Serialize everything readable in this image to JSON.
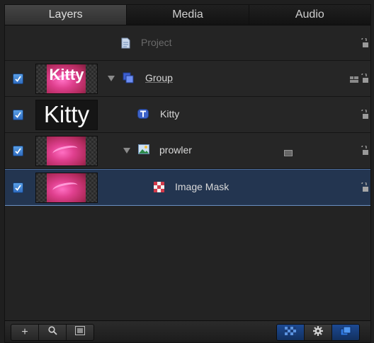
{
  "tabs": [
    {
      "label": "Layers"
    },
    {
      "label": "Media"
    },
    {
      "label": "Audio"
    }
  ],
  "rows": [
    {
      "name": "Project",
      "checked": false,
      "icon": "project-document-icon"
    },
    {
      "name": "Group",
      "checked": true,
      "expanded": true,
      "icon": "group-icon",
      "thumb_text": "Kitty"
    },
    {
      "name": "Kitty",
      "checked": true,
      "icon": "text-layer-icon",
      "thumb_text": "Kitty"
    },
    {
      "name": "prowler",
      "checked": true,
      "expanded": true,
      "icon": "image-layer-icon"
    },
    {
      "name": "Image Mask",
      "checked": true,
      "selected": true,
      "icon": "image-mask-icon"
    }
  ],
  "footer": {
    "left_buttons": [
      "add-icon",
      "search-icon",
      "thumbnail-view-icon"
    ],
    "right_buttons": [
      "checkerboard-icon",
      "gear-icon",
      "layers-stack-icon"
    ],
    "add_glyph": "+"
  },
  "colors": {
    "selected_row": "#233550",
    "checkbox": "#3d83d4",
    "accent": "#2b63b8"
  }
}
